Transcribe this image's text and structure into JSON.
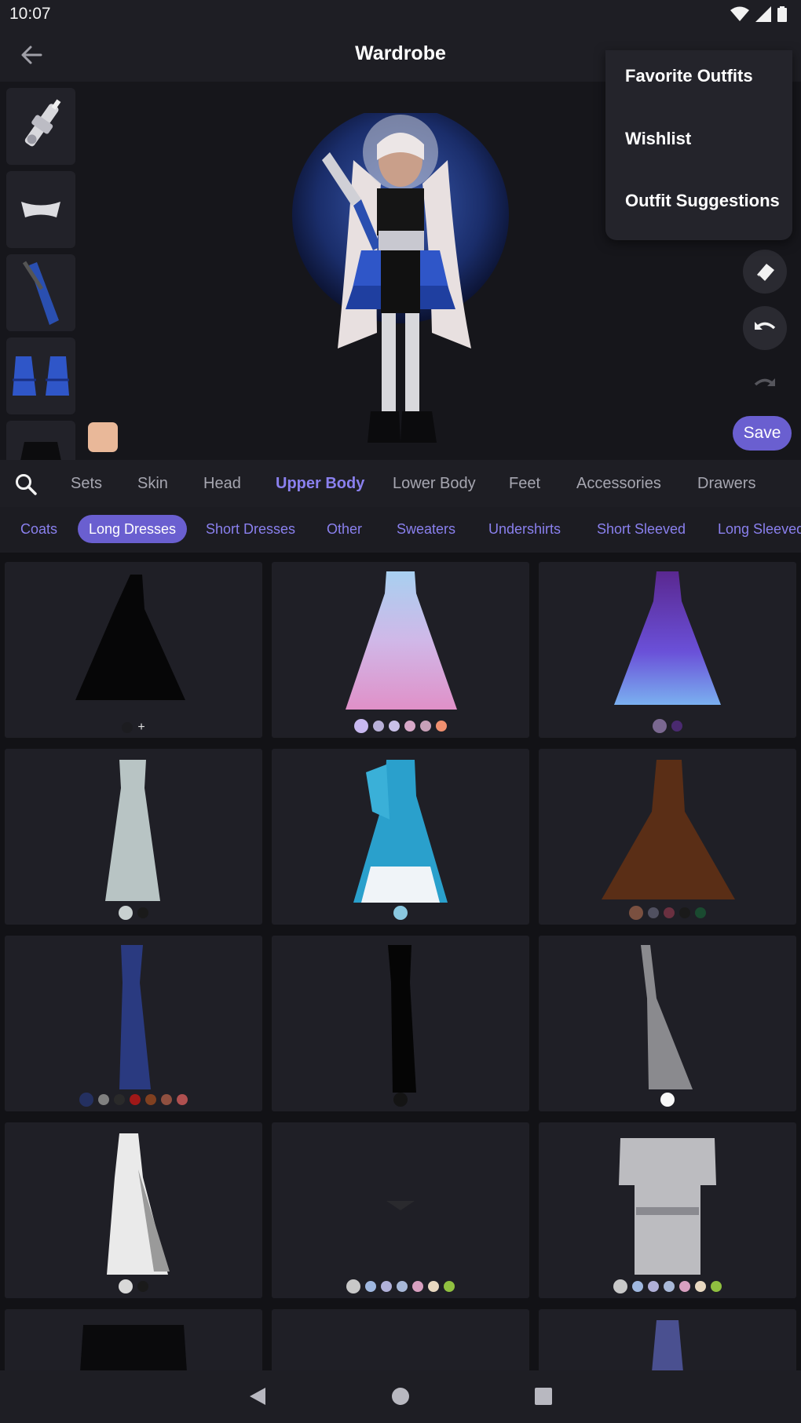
{
  "status": {
    "time": "10:07"
  },
  "app": {
    "title": "Wardrobe"
  },
  "menu": {
    "items": [
      "Favorite Outfits",
      "Wishlist",
      "Outfit Suggestions"
    ]
  },
  "toolbar": {
    "save_label": "Save"
  },
  "categories": [
    "Sets",
    "Skin",
    "Head",
    "Upper Body",
    "Lower Body",
    "Feet",
    "Accessories",
    "Drawers"
  ],
  "active_category": "Upper Body",
  "subcategories": [
    "Coats",
    "Long Dresses",
    "Short Dresses",
    "Other",
    "Sweaters",
    "Undershirts",
    "Short Sleeved",
    "Long Sleeved"
  ],
  "active_subcategory": "Long Dresses",
  "colors": {
    "accent": "#6a5fd0",
    "accent_text": "#8a80ee",
    "skin_tone": "#e9b899"
  },
  "items": [
    {
      "name": "black gown",
      "swatches": [
        "#1c1c20"
      ],
      "extra": "+"
    },
    {
      "name": "pink gradient gown",
      "swatches": [
        "#c8b8f0",
        "#b8b0d8",
        "#c8c0e8",
        "#d8a8c8",
        "#c8a0b8",
        "#f09070"
      ]
    },
    {
      "name": "purple galaxy gown",
      "swatches": [
        "#7a6890",
        "#4a2a70"
      ]
    },
    {
      "name": "silver gown",
      "swatches": [
        "#c8d0d0",
        "#1a1a1a"
      ]
    },
    {
      "name": "blue ball gown",
      "swatches": [
        "#8ac8e0"
      ]
    },
    {
      "name": "brown gown",
      "swatches": [
        "#7a5040",
        "#505060",
        "#6a3040",
        "#1a1a1a",
        "#1a4a30"
      ]
    },
    {
      "name": "navy gown",
      "swatches": [
        "#243060",
        "#808080",
        "#2a2a2a",
        "#a01818",
        "#804020",
        "#905040",
        "#b05050"
      ]
    },
    {
      "name": "black column gown",
      "swatches": [
        "#141414"
      ]
    },
    {
      "name": "grey veil",
      "swatches": [
        "#f8f8f8"
      ]
    },
    {
      "name": "white slip gown",
      "swatches": [
        "#d8d8d8",
        "#1a1a1a"
      ]
    },
    {
      "name": "small item",
      "swatches": [
        "#c8c8c8",
        "#a0b8e0",
        "#b0b0d8",
        "#a8b8d8",
        "#d8a0c0",
        "#e8d8c0",
        "#90c040"
      ]
    },
    {
      "name": "silver coat",
      "swatches": [
        "#c8c8c8",
        "#a0b8e0",
        "#b0b0d8",
        "#a8b8d8",
        "#d8a0c0",
        "#e8d8c0",
        "#90c040"
      ]
    },
    {
      "name": "black jacket",
      "swatches": []
    },
    {
      "name": "empty",
      "swatches": []
    },
    {
      "name": "galaxy dress",
      "swatches": []
    }
  ]
}
